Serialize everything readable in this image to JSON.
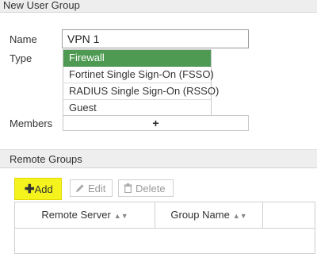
{
  "header": {
    "title": "New User Group"
  },
  "form": {
    "name_label": "Name",
    "name_value": "VPN 1",
    "type_label": "Type",
    "type_options": [
      {
        "label": "Firewall",
        "selected": true
      },
      {
        "label": "Fortinet Single Sign-On (FSSO)",
        "selected": false
      },
      {
        "label": "RADIUS Single Sign-On (RSSO)",
        "selected": false
      },
      {
        "label": "Guest",
        "selected": false
      }
    ],
    "members_label": "Members",
    "members_add": "+"
  },
  "remote_groups": {
    "title": "Remote Groups",
    "toolbar": {
      "add_label": "Add",
      "edit_label": "Edit",
      "delete_label": "Delete"
    },
    "columns": [
      "Remote Server",
      "Group Name"
    ],
    "rows": []
  },
  "colors": {
    "selected_option_bg": "#4e9a52",
    "add_button_highlight": "#f4f31e"
  },
  "icons": {
    "add": "plus-icon",
    "edit": "pencil-icon",
    "delete": "trash-icon",
    "sort": "sort-icon"
  }
}
